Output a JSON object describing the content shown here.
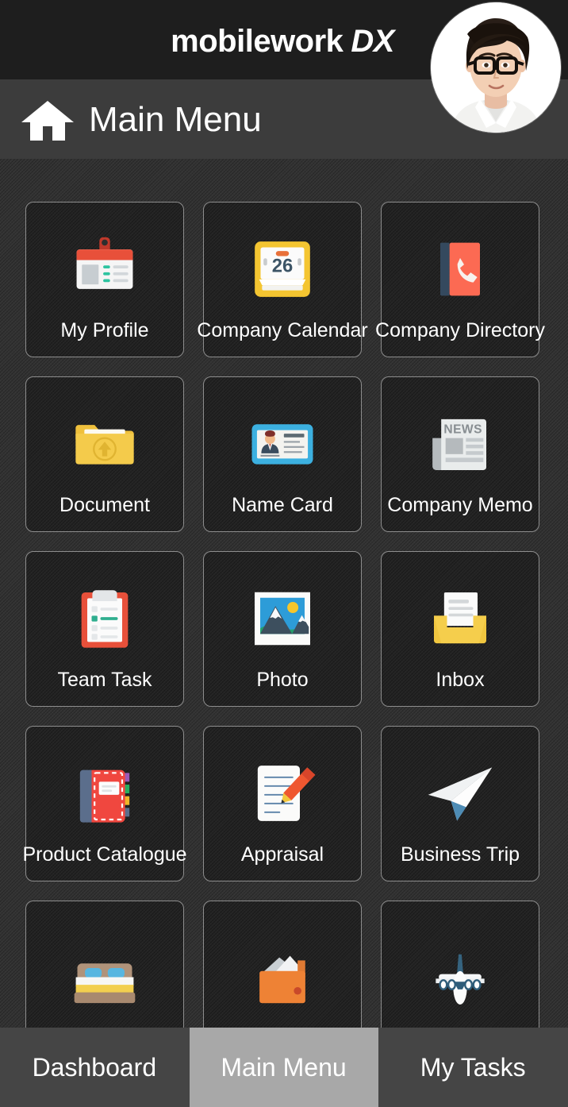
{
  "app": {
    "brand_name": "mobilework",
    "brand_suffix": "DX",
    "accent_dark": "#1e1e1e",
    "titlebar_color": "#3c3c3c",
    "tile_color": "#242424",
    "tile_border": "#8d8d8d",
    "tab_active_color": "#a8a8a8"
  },
  "header": {
    "page_title": "Main Menu",
    "home_icon": "home-icon",
    "avatar": "user-avatar"
  },
  "menu": {
    "items": [
      {
        "label": "My Profile",
        "icon": "id-badge-icon"
      },
      {
        "label": "Company Calendar",
        "icon": "calendar-icon",
        "badge": "26"
      },
      {
        "label": "Company Directory",
        "icon": "phone-book-icon"
      },
      {
        "label": "Document",
        "icon": "folder-upload-icon"
      },
      {
        "label": "Name Card",
        "icon": "name-card-icon"
      },
      {
        "label": "Company Memo",
        "icon": "newspaper-icon",
        "badge": "NEWS"
      },
      {
        "label": "Team Task",
        "icon": "clipboard-icon"
      },
      {
        "label": "Photo",
        "icon": "photo-icon"
      },
      {
        "label": "Inbox",
        "icon": "inbox-tray-icon"
      },
      {
        "label": "Product Catalogue",
        "icon": "notebook-icon"
      },
      {
        "label": "Appraisal",
        "icon": "pencil-paper-icon"
      },
      {
        "label": "Business Trip",
        "icon": "paper-plane-icon"
      },
      {
        "label": "",
        "icon": "bed-icon"
      },
      {
        "label": "",
        "icon": "wallet-icon"
      },
      {
        "label": "",
        "icon": "airplane-icon"
      }
    ]
  },
  "tabs": [
    {
      "label": "Dashboard",
      "active": false
    },
    {
      "label": "Main Menu",
      "active": true
    },
    {
      "label": "My Tasks",
      "active": false
    }
  ]
}
